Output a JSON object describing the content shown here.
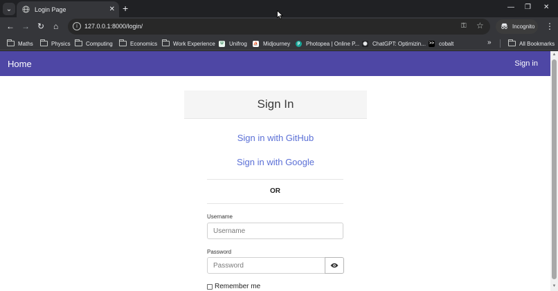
{
  "browser": {
    "tab": {
      "title": "Login Page",
      "close_glyph": "✕"
    },
    "new_tab_glyph": "+",
    "tab_search_glyph": "⌄",
    "window_controls": {
      "minimize": "—",
      "restore": "❐",
      "close": "✕"
    },
    "url": "127.0.0.1:8000/login/",
    "profile_label": "Incognito",
    "toolbar_glyphs": {
      "back": "←",
      "forward": "→",
      "reload": "↻",
      "home": "⌂",
      "star": "☆",
      "menu": "⋮",
      "key": "⚿"
    },
    "bookmarks": [
      {
        "label": "Maths",
        "icon": "folder-icon"
      },
      {
        "label": "Physics",
        "icon": "folder-icon"
      },
      {
        "label": "Computing",
        "icon": "folder-icon"
      },
      {
        "label": "Economics",
        "icon": "folder-icon"
      },
      {
        "label": "Work Experience",
        "icon": "folder-icon"
      },
      {
        "label": "Unifrog",
        "icon": "unifrog-icon",
        "icon_text": "U",
        "icon_color": "#e9f5ee"
      },
      {
        "label": "Midjourney",
        "icon": "midjourney-icon",
        "icon_text": "⛵",
        "icon_color": "#ffffff"
      },
      {
        "label": "Photopea | Online P...",
        "icon": "photopea-icon",
        "icon_text": "p",
        "icon_color": "#18a497"
      },
      {
        "label": "ChatGPT: Optimizin...",
        "icon": "chatgpt-icon",
        "icon_text": "✺",
        "icon_color": "#202124"
      },
      {
        "label": "cobalt",
        "icon": "cobalt-icon",
        "icon_text": ">>",
        "icon_color": "#000000"
      }
    ],
    "bookmarks_more": "»",
    "all_bookmarks_label": "All Bookmarks"
  },
  "page": {
    "navbar": {
      "home": "Home",
      "sign_in": "Sign in",
      "color": "#4e47a5"
    },
    "card_title": "Sign In",
    "social_links": [
      "Sign in with GitHub",
      "Sign in with Google"
    ],
    "divider_text": "OR",
    "username": {
      "label": "Username",
      "placeholder": "Username",
      "value": ""
    },
    "password": {
      "label": "Password",
      "placeholder": "Password",
      "value": ""
    },
    "remember_me": "Remember me",
    "link_color": "#5a6fd6"
  },
  "scrollbar_glyphs": {
    "up": "▲",
    "down": "▼"
  }
}
